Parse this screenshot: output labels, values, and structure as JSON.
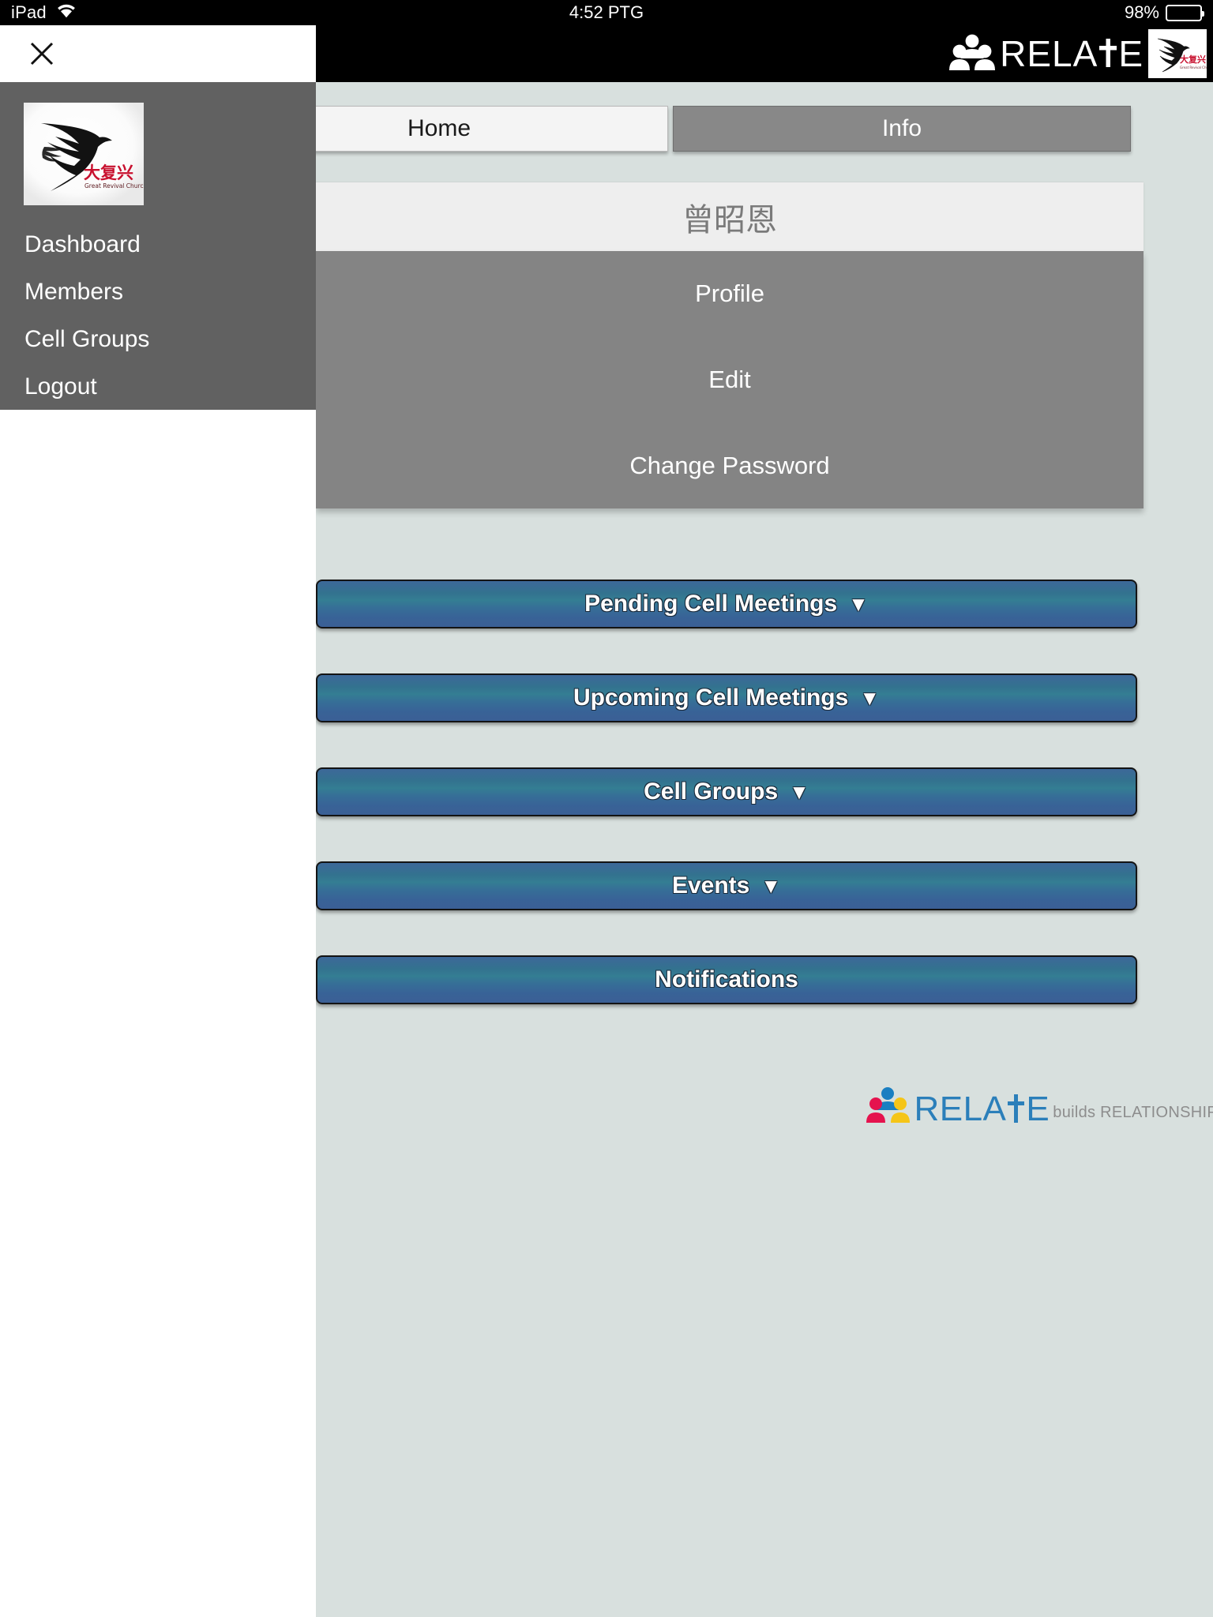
{
  "status_bar": {
    "device": "iPad",
    "wifi_icon": "wifi-icon",
    "time": "4:52 PTG",
    "battery_percent": "98%",
    "battery_level": 98
  },
  "app_header": {
    "logo_text": "RELATE",
    "logo_icon": "people-group-icon",
    "church_logo_icon": "dove-church-logo-icon"
  },
  "tabs": [
    {
      "label": "Home",
      "active": true
    },
    {
      "label": "Info",
      "active": false
    }
  ],
  "user": {
    "name": "曾昭恩"
  },
  "account_links": [
    {
      "label": "Profile"
    },
    {
      "label": "Edit"
    },
    {
      "label": "Change Password"
    }
  ],
  "dashboard_buttons": [
    {
      "label": "Pending Cell Meetings",
      "caret": "▼"
    },
    {
      "label": "Upcoming Cell Meetings",
      "caret": "▼"
    },
    {
      "label": "Cell Groups",
      "caret": "▼"
    },
    {
      "label": "Events",
      "caret": "▼"
    },
    {
      "label": "Notifications",
      "caret": ""
    }
  ],
  "footer": {
    "logo_text": "RELATE",
    "tagline": "builds RELATIONSHIP",
    "logo_icon": "people-group-color-icon"
  },
  "drawer": {
    "close_icon": "close-icon",
    "logo_icon": "dove-church-logo-icon",
    "items": [
      {
        "label": "Dashboard"
      },
      {
        "label": "Members"
      },
      {
        "label": "Cell Groups"
      },
      {
        "label": "Logout"
      }
    ]
  },
  "colors": {
    "status_bar_bg": "#000000",
    "header_bg": "#000000",
    "content_bg": "#d8e0de",
    "drawer_bg": "#616161",
    "panel_gray": "#848484",
    "namecard_bg": "#eeeeee",
    "button_blue_top": "#3d6899",
    "button_blue_mid": "#347e93",
    "button_blue_bottom": "#3b5f95",
    "footer_logo_blue": "#2b7fba",
    "footer_tagline_gray": "#8d8d8d",
    "church_red": "#c8102e"
  }
}
